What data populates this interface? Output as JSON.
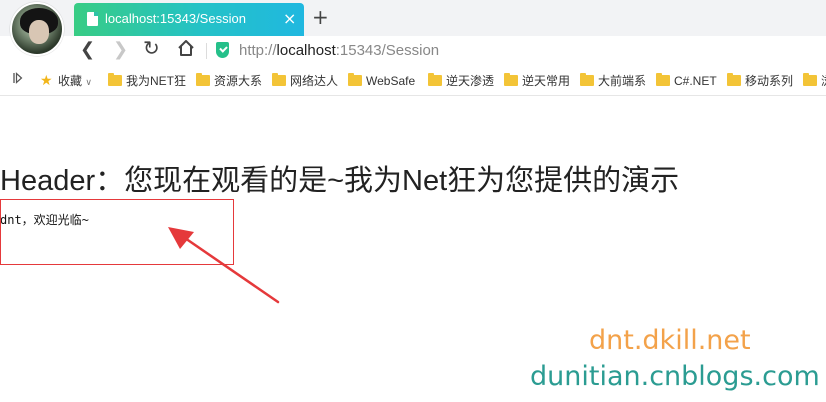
{
  "browser": {
    "tab": {
      "title": "localhost:15343/Session",
      "close": "×"
    },
    "new_tab": "+",
    "address": {
      "scheme": "http://",
      "host": "localhost",
      "rest": ":15343/Session"
    },
    "nav_icons": {
      "back": "‹",
      "forward": "›",
      "reload": "↻",
      "home": "⌂"
    },
    "bookmarks": {
      "toggle": "I▷",
      "favorites": "收藏",
      "items": [
        "我为NET狂",
        "资源大系",
        "网络达人",
        "WebSafe",
        "逆天渗透",
        "逆天常用",
        "大前端系",
        "C#.NET",
        "移动系列",
        "浏"
      ]
    }
  },
  "page": {
    "heading": "Header：您现在观看的是~我为Net狂为您提供的演示",
    "message": "dnt，欢迎光临~"
  },
  "watermark": {
    "line1": "dnt.dkill.net",
    "line2": "dunitian.cnblogs.com"
  },
  "colors": {
    "tab_gradient_start": "#38cc84",
    "tab_gradient_end": "#20b8e0",
    "highlight": "#e5393b",
    "watermark_orange": "#f3a24a",
    "watermark_teal": "#2b9c92"
  }
}
